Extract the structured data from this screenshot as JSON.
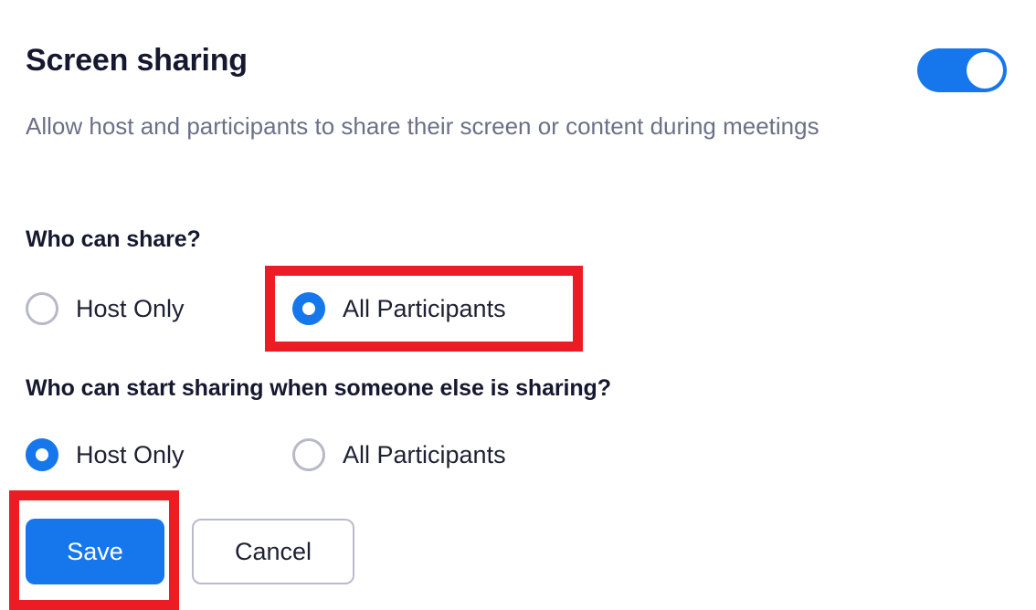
{
  "setting": {
    "title": "Screen sharing",
    "description": "Allow host and participants to share their screen or content during meetings",
    "toggle": {
      "name": "screen-sharing-toggle",
      "state": "on",
      "accent_color": "#1677ed"
    }
  },
  "groups": [
    {
      "heading": "Who can share?",
      "options": [
        {
          "label": "Host Only",
          "selected": false
        },
        {
          "label": "All Participants",
          "selected": true
        }
      ]
    },
    {
      "heading": "Who can start sharing when someone else is sharing?",
      "options": [
        {
          "label": "Host Only",
          "selected": true
        },
        {
          "label": "All Participants",
          "selected": false
        }
      ]
    }
  ],
  "actions": {
    "save_label": "Save",
    "cancel_label": "Cancel"
  },
  "annotations": {
    "highlight_color": "#ed1c24",
    "boxes": [
      {
        "target": "all-participants-radio-group-1"
      },
      {
        "target": "save-button"
      }
    ]
  },
  "colors": {
    "accent_blue": "#1677ed",
    "text_primary": "#16182f",
    "text_secondary": "#6c7086",
    "radio_off_border": "#b7b9c9",
    "button_border": "#b9bbcb",
    "highlight_red": "#ed1c24"
  }
}
